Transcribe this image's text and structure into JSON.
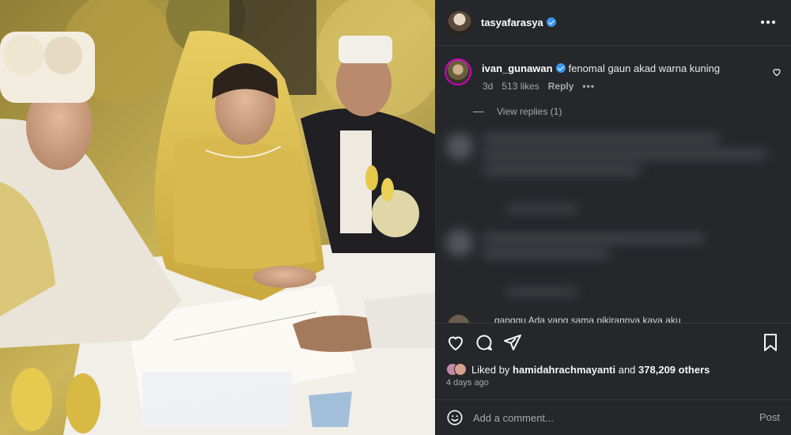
{
  "post": {
    "author": "tasyafarasya",
    "author_verified": true,
    "photo_alt": "Bride in yellow lace gown signing a document at a wedding ceremony"
  },
  "comment": {
    "username": "ivan_gunawan",
    "verified": true,
    "text": "fenomal gaun akad warna kuning",
    "age": "3d",
    "likes": "513 likes",
    "reply_label": "Reply",
    "more_label": "•••",
    "view_replies": "View replies (1)"
  },
  "blurred_partial": "ganggu Ada yang sama pikirannya kaya aku",
  "likes": {
    "prefix": "Liked by",
    "user": "hamidahrachmayanti",
    "and": "and",
    "count": "378,209 others"
  },
  "time_ago": "4 days ago",
  "add_comment": {
    "placeholder": "Add a comment...",
    "post_label": "Post"
  },
  "icons": {
    "heart": "heart-icon",
    "comment": "comment-icon",
    "share": "share-icon",
    "save": "bookmark-icon",
    "more": "more-icon",
    "emoji": "emoji-icon"
  },
  "colors": {
    "panel_bg": "#26272b",
    "verified_blue": "#3897f0",
    "muted_text": "#a8a8a8",
    "story_ring": "#d300c5"
  }
}
